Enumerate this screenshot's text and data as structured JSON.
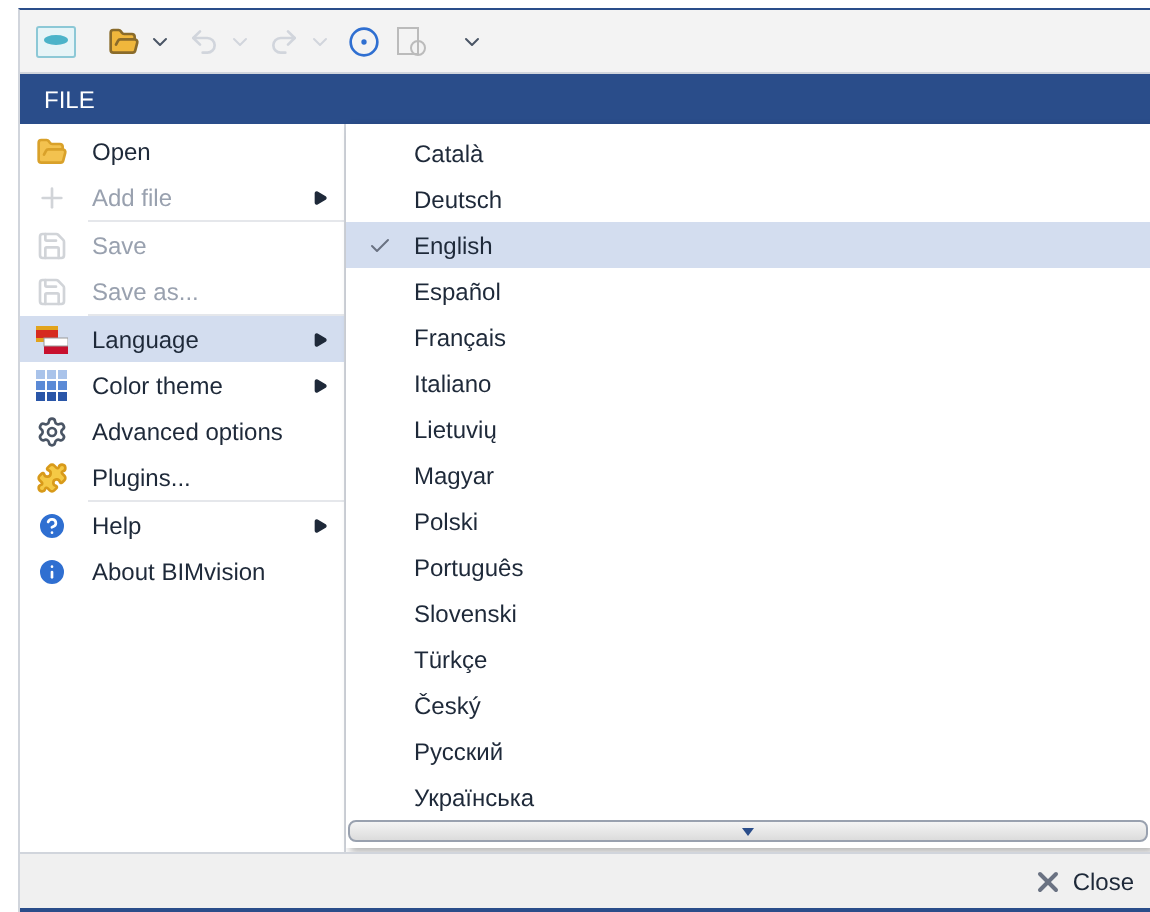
{
  "ribbon": {
    "tab": "FILE"
  },
  "menu": {
    "groups": [
      [
        {
          "label": "Open",
          "disabled": false,
          "submenu": false,
          "selected": false
        },
        {
          "label": "Add file",
          "disabled": true,
          "submenu": true,
          "selected": false
        }
      ],
      [
        {
          "label": "Save",
          "disabled": true,
          "submenu": false,
          "selected": false
        },
        {
          "label": "Save as...",
          "disabled": true,
          "submenu": false,
          "selected": false
        }
      ],
      [
        {
          "label": "Language",
          "disabled": false,
          "submenu": true,
          "selected": true
        },
        {
          "label": "Color theme",
          "disabled": false,
          "submenu": true,
          "selected": false
        },
        {
          "label": "Advanced options",
          "disabled": false,
          "submenu": false,
          "selected": false
        },
        {
          "label": "Plugins...",
          "disabled": false,
          "submenu": false,
          "selected": false
        }
      ],
      [
        {
          "label": "Help",
          "disabled": false,
          "submenu": true,
          "selected": false
        },
        {
          "label": "About BIMvision",
          "disabled": false,
          "submenu": false,
          "selected": false
        }
      ]
    ]
  },
  "languages": [
    {
      "label": "Català",
      "selected": false
    },
    {
      "label": "Deutsch",
      "selected": false
    },
    {
      "label": "English",
      "selected": true
    },
    {
      "label": "Español",
      "selected": false
    },
    {
      "label": "Français",
      "selected": false
    },
    {
      "label": "Italiano",
      "selected": false
    },
    {
      "label": "Lietuvių",
      "selected": false
    },
    {
      "label": "Magyar",
      "selected": false
    },
    {
      "label": "Polski",
      "selected": false
    },
    {
      "label": "Português",
      "selected": false
    },
    {
      "label": "Slovenski",
      "selected": false
    },
    {
      "label": "Türkçe",
      "selected": false
    },
    {
      "label": "Český",
      "selected": false
    },
    {
      "label": "Русский",
      "selected": false
    },
    {
      "label": "Українська",
      "selected": false
    }
  ],
  "footer": {
    "close": "Close"
  }
}
